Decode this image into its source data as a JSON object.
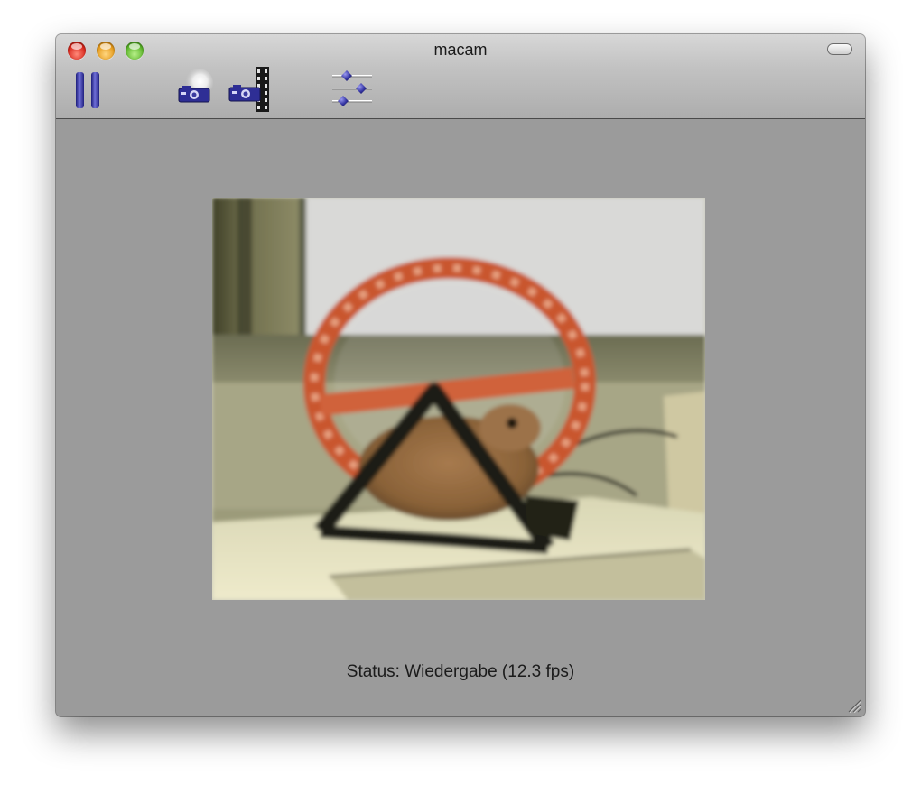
{
  "window": {
    "title": "macam"
  },
  "toolbar": {
    "items": [
      {
        "name": "pause",
        "icon": "pause-icon"
      },
      {
        "name": "snapshot",
        "icon": "camera-flash-icon"
      },
      {
        "name": "record-movie",
        "icon": "camera-film-icon"
      },
      {
        "name": "settings",
        "icon": "sliders-icon"
      }
    ]
  },
  "viewport": {
    "content": "webcam-live-image"
  },
  "status": {
    "text": "Status: Wiedergabe (12.3 fps)"
  },
  "colors": {
    "window_bg": "#9b9b9b",
    "icon_blue": "#3a3aa0",
    "close": "#d8261b",
    "minimize": "#e59a1b",
    "zoom": "#5cb52a"
  }
}
